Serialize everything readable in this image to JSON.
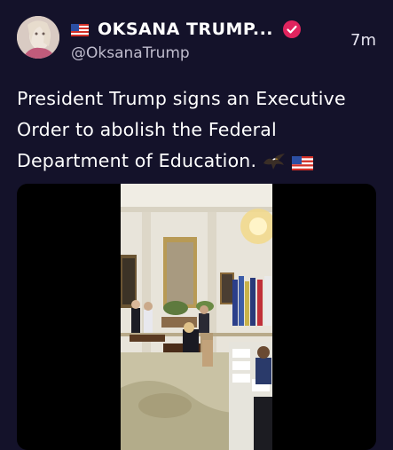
{
  "post": {
    "author_name": "OKSANA TRUMP...",
    "author_handle": "@OksanaTrump",
    "timestamp": "7m",
    "text": "President Trump signs an Executive Order to abolish the Federal Department of Education.",
    "icons": [
      "us-flag-icon",
      "verified-badge-icon",
      "eagle-icon",
      "us-flag-icon"
    ],
    "colors": {
      "background": "#14122a",
      "verified_badge": "#e0245e",
      "text": "#ffffff",
      "muted": "#bfbccd"
    }
  }
}
